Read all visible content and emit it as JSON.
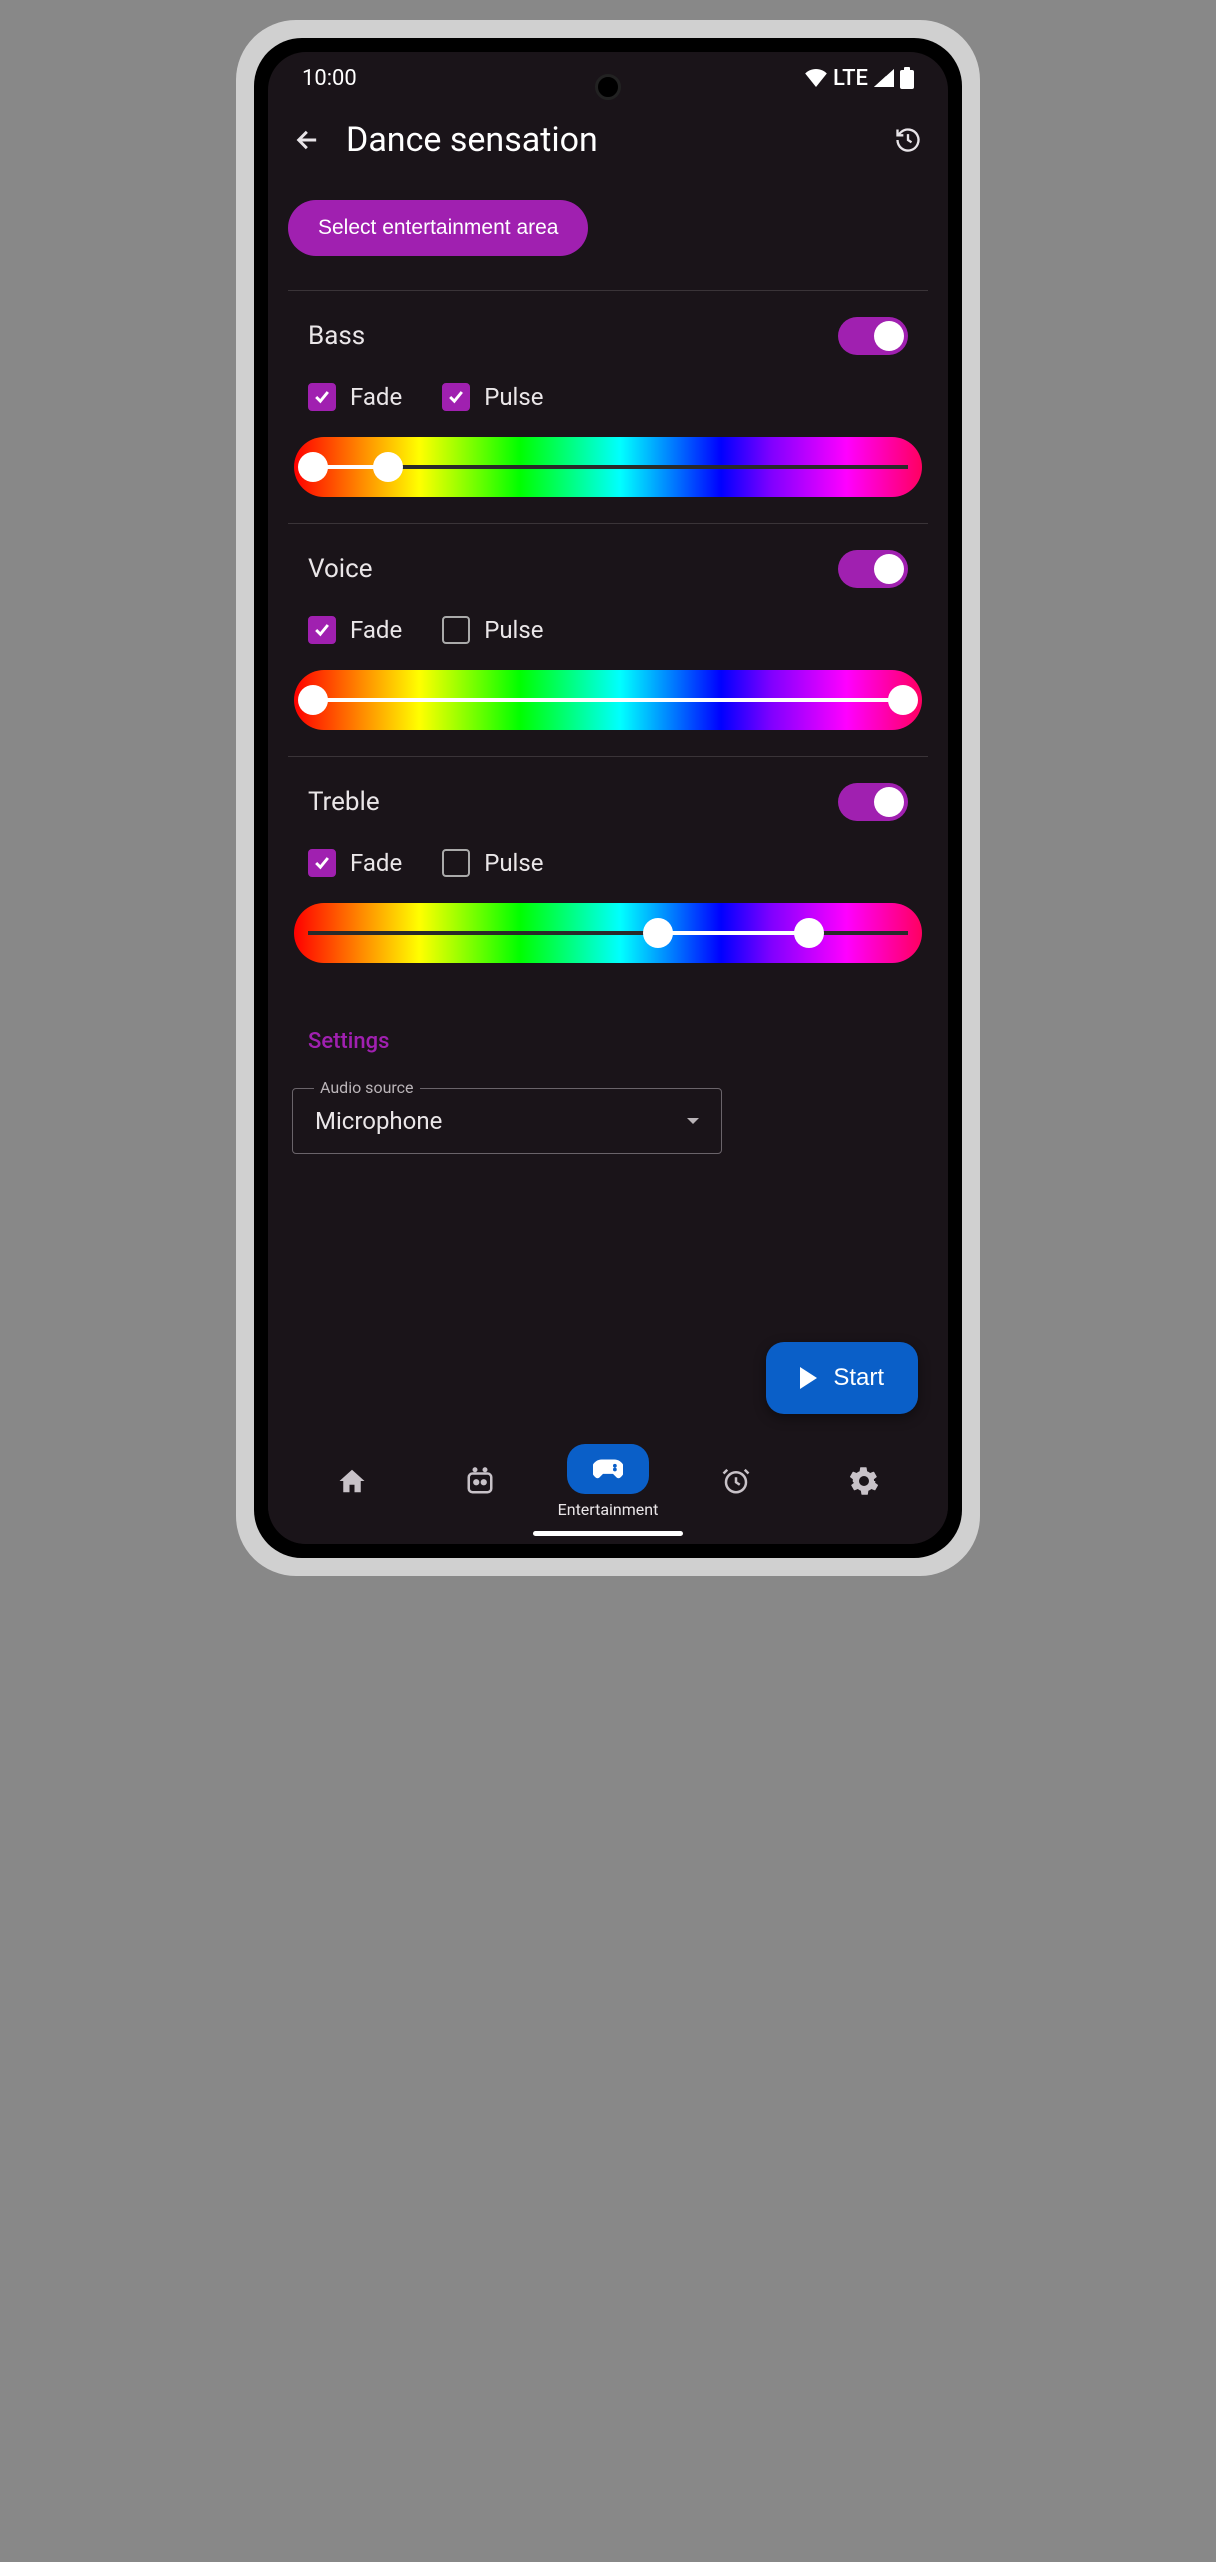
{
  "status": {
    "time": "10:00",
    "network": "LTE"
  },
  "header": {
    "title": "Dance sensation"
  },
  "buttons": {
    "select_area": "Select entertainment area",
    "start": "Start"
  },
  "sections": {
    "bass": {
      "title": "Bass",
      "toggle": true,
      "fade_label": "Fade",
      "fade_checked": true,
      "pulse_label": "Pulse",
      "pulse_checked": true,
      "slider_low": 3,
      "slider_high": 15
    },
    "voice": {
      "title": "Voice",
      "toggle": true,
      "fade_label": "Fade",
      "fade_checked": true,
      "pulse_label": "Pulse",
      "pulse_checked": false,
      "slider_low": 3,
      "slider_high": 97
    },
    "treble": {
      "title": "Treble",
      "toggle": true,
      "fade_label": "Fade",
      "fade_checked": true,
      "pulse_label": "Pulse",
      "pulse_checked": false,
      "slider_low": 58,
      "slider_high": 82
    }
  },
  "settings": {
    "label": "Settings",
    "audio_source_label": "Audio source",
    "audio_source_value": "Microphone"
  },
  "nav": {
    "active_label": "Entertainment"
  }
}
